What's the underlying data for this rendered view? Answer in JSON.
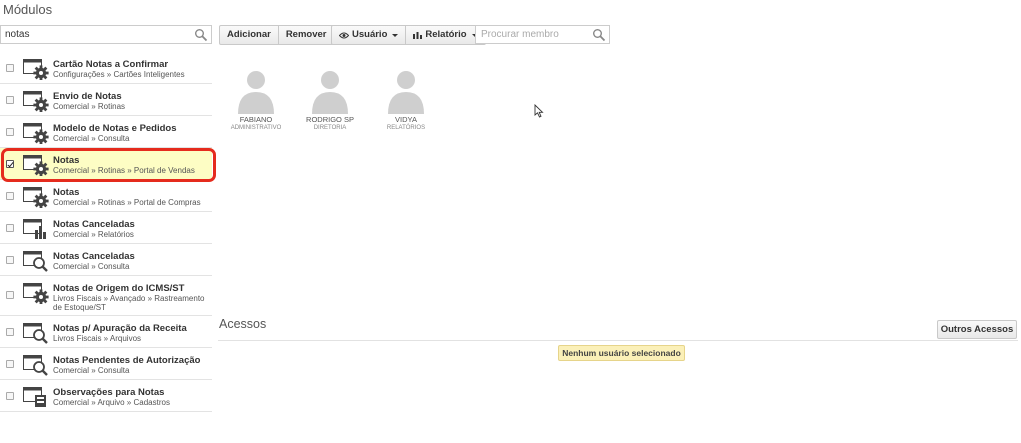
{
  "page_title": "Módulos",
  "search": {
    "value": "notas"
  },
  "toolbar": {
    "add_label": "Adicionar",
    "remove_label": "Remover",
    "user_label": "Usuário",
    "report_label": "Relatório",
    "member_search_placeholder": "Procurar membro"
  },
  "modules": [
    {
      "name": "Cartão Notas a Confirmar",
      "path": "Configurações » Cartões Inteligentes",
      "icon": "gear-icon",
      "checked": false
    },
    {
      "name": "Envio de Notas",
      "path": "Comercial » Rotinas",
      "icon": "gear-icon",
      "checked": false
    },
    {
      "name": "Modelo de Notas e Pedidos",
      "path": "Comercial » Consulta",
      "icon": "gear-icon",
      "checked": false
    },
    {
      "name": "Notas",
      "path": "Comercial » Rotinas » Portal de Vendas",
      "icon": "gear-icon",
      "checked": true
    },
    {
      "name": "Notas",
      "path": "Comercial » Rotinas » Portal de Compras",
      "icon": "gear-icon",
      "checked": false
    },
    {
      "name": "Notas Canceladas",
      "path": "Comercial » Relatórios",
      "icon": "bar-chart-icon",
      "checked": false
    },
    {
      "name": "Notas Canceladas",
      "path": "Comercial » Consulta",
      "icon": "magnifier-icon",
      "checked": false
    },
    {
      "name": "Notas de Origem do ICMS/ST",
      "path": "Livros Fiscais » Avançado » Rastreamento de Estoque/ST",
      "icon": "gear-icon",
      "checked": false
    },
    {
      "name": "Notas p/ Apuração da Receita",
      "path": "Livros Fiscais » Arquivos",
      "icon": "magnifier-icon",
      "checked": false
    },
    {
      "name": "Notas Pendentes de Autorização",
      "path": "Comercial » Consulta",
      "icon": "magnifier-icon",
      "checked": false
    },
    {
      "name": "Observações para Notas",
      "path": "Comercial » Arquivo » Cadastros",
      "icon": "form-icon",
      "checked": false
    }
  ],
  "members": [
    {
      "name": "FABIANO",
      "role": "ADMINISTRATIVO"
    },
    {
      "name": "RODRIGO SP",
      "role": "DIRETORIA"
    },
    {
      "name": "VIDYA",
      "role": "RELATÓRIOS"
    }
  ],
  "acessos": {
    "title": "Acessos",
    "other_button": "Outros Acessos",
    "notice": "Nenhum usuário selecionado"
  },
  "colors": {
    "highlight": "#fdfdc4",
    "highlight_border": "#e52b1d",
    "notice_bg": "#fbf0b8"
  }
}
